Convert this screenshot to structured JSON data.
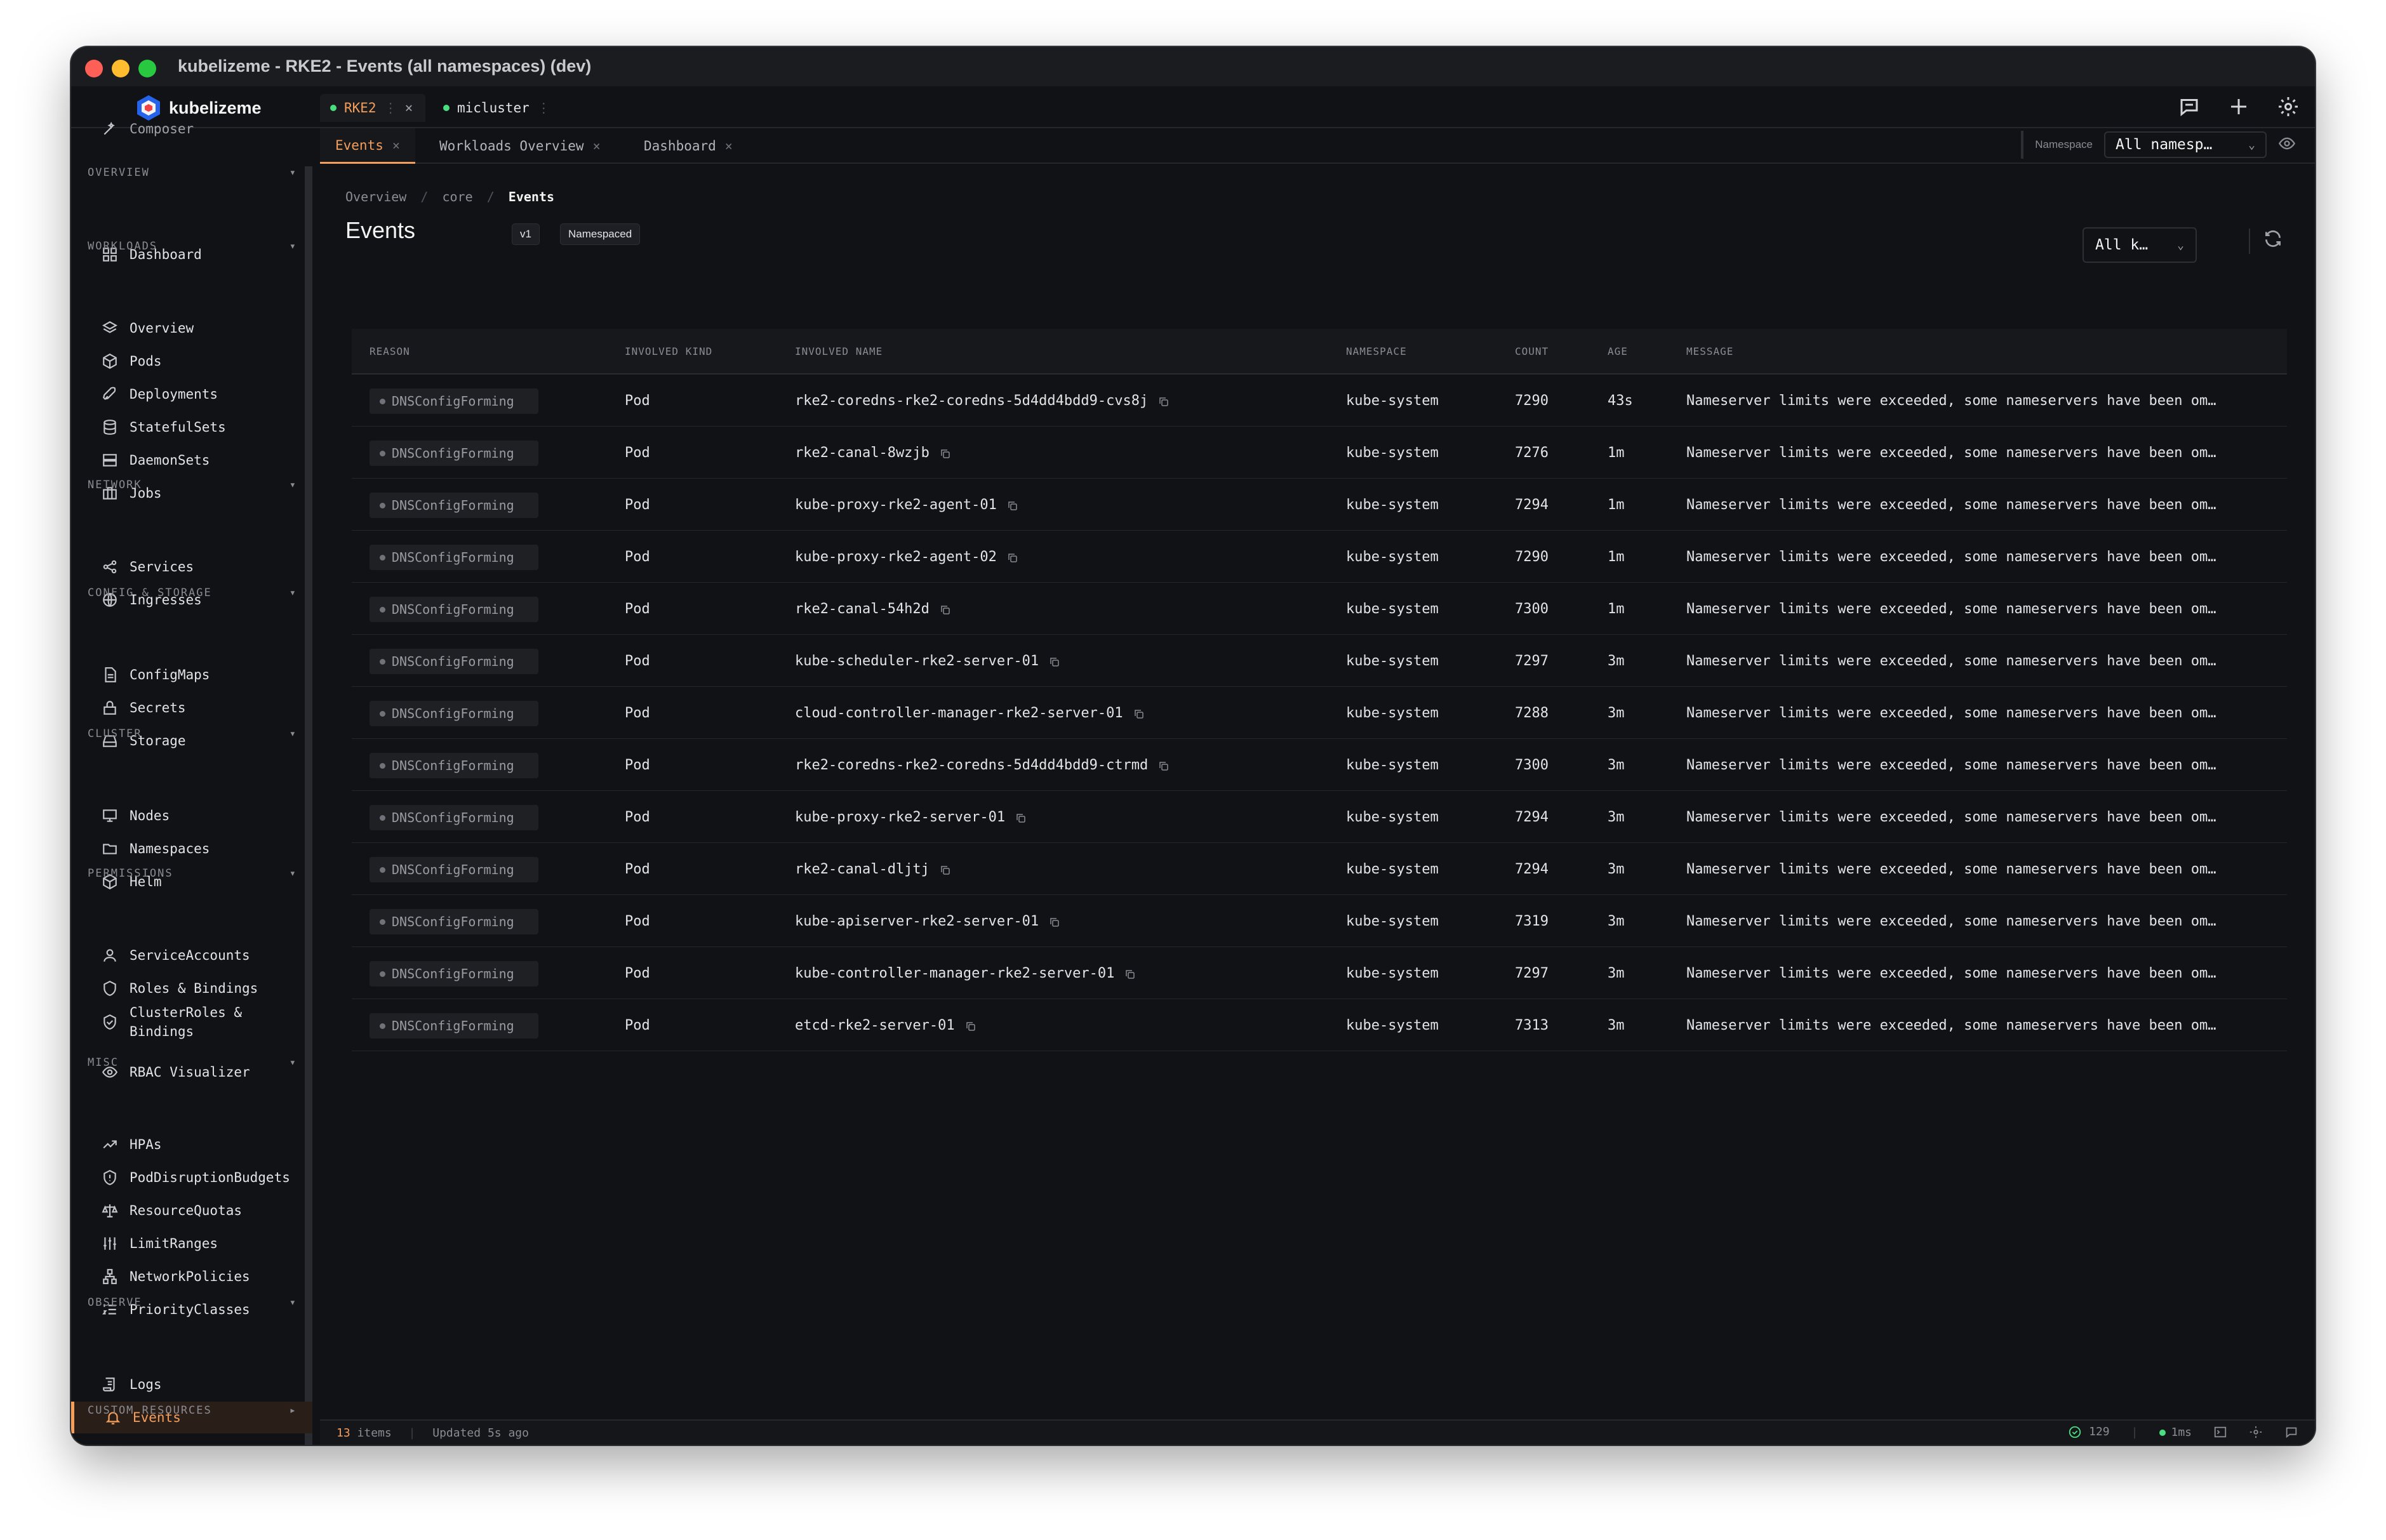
{
  "window": {
    "title": "kubelizeme - RKE2 - Events (all namespaces) (dev)"
  },
  "brand": {
    "name": "kubelizeme"
  },
  "context_tabs": [
    {
      "label": "RKE2",
      "close": "×"
    },
    {
      "label": "micluster",
      "menu": "⋮"
    }
  ],
  "sidebar": {
    "cut_item": "Composer",
    "sections": {
      "overview": "OVERVIEW",
      "workloads": "WORKLOADS",
      "network": "NETWORK",
      "config": "CONFIG & STORAGE",
      "cluster": "CLUSTER",
      "permissions": "PERMISSIONS",
      "misc": "MISC",
      "observe": "OBSERVE",
      "custom": "CUSTOM RESOURCES"
    },
    "items": {
      "dashboard": "Dashboard",
      "overview": "Overview",
      "pods": "Pods",
      "deployments": "Deployments",
      "statefulsets": "StatefulSets",
      "daemonsets": "DaemonSets",
      "jobs": "Jobs",
      "services": "Services",
      "ingresses": "Ingresses",
      "configmaps": "ConfigMaps",
      "secrets": "Secrets",
      "storage": "Storage",
      "nodes": "Nodes",
      "namespaces": "Namespaces",
      "helm": "Helm",
      "serviceaccounts": "ServiceAccounts",
      "roles": "Roles & Bindings",
      "clusterroles_1": "ClusterRoles &",
      "clusterroles_2": "Bindings",
      "rbac": "RBAC Visualizer",
      "hpas": "HPAs",
      "pdb": "PodDisruptionBudgets",
      "quotas": "ResourceQuotas",
      "limits": "LimitRanges",
      "netpol": "NetworkPolicies",
      "priority": "PriorityClasses",
      "logs": "Logs",
      "events": "Events"
    }
  },
  "page_tabs": [
    {
      "label": "Events"
    },
    {
      "label": "Workloads Overview"
    },
    {
      "label": "Dashboard"
    }
  ],
  "namespace": {
    "label": "Namespace",
    "value": "All namesp…"
  },
  "breadcrumb": {
    "a": "Overview",
    "b": "core",
    "c": "Events",
    "sep": "/"
  },
  "header": {
    "title": "Events",
    "version": "v1",
    "scope": "Namespaced",
    "kind_filter": "All k…"
  },
  "table": {
    "columns": [
      "REASON",
      "INVOLVED KIND",
      "INVOLVED NAME",
      "NAMESPACE",
      "COUNT",
      "AGE",
      "MESSAGE"
    ],
    "rows": [
      {
        "reason": "DNSConfigForming",
        "kind": "Pod",
        "name": "rke2-coredns-rke2-coredns-5d4dd4bdd9-cvs8j",
        "namespace": "kube-system",
        "count": "7290",
        "age": "43s",
        "message": "Nameserver limits were exceeded, some nameservers have been om…"
      },
      {
        "reason": "DNSConfigForming",
        "kind": "Pod",
        "name": "rke2-canal-8wzjb",
        "namespace": "kube-system",
        "count": "7276",
        "age": "1m",
        "message": "Nameserver limits were exceeded, some nameservers have been om…"
      },
      {
        "reason": "DNSConfigForming",
        "kind": "Pod",
        "name": "kube-proxy-rke2-agent-01",
        "namespace": "kube-system",
        "count": "7294",
        "age": "1m",
        "message": "Nameserver limits were exceeded, some nameservers have been om…"
      },
      {
        "reason": "DNSConfigForming",
        "kind": "Pod",
        "name": "kube-proxy-rke2-agent-02",
        "namespace": "kube-system",
        "count": "7290",
        "age": "1m",
        "message": "Nameserver limits were exceeded, some nameservers have been om…"
      },
      {
        "reason": "DNSConfigForming",
        "kind": "Pod",
        "name": "rke2-canal-54h2d",
        "namespace": "kube-system",
        "count": "7300",
        "age": "1m",
        "message": "Nameserver limits were exceeded, some nameservers have been om…"
      },
      {
        "reason": "DNSConfigForming",
        "kind": "Pod",
        "name": "kube-scheduler-rke2-server-01",
        "namespace": "kube-system",
        "count": "7297",
        "age": "3m",
        "message": "Nameserver limits were exceeded, some nameservers have been om…"
      },
      {
        "reason": "DNSConfigForming",
        "kind": "Pod",
        "name": "cloud-controller-manager-rke2-server-01",
        "namespace": "kube-system",
        "count": "7288",
        "age": "3m",
        "message": "Nameserver limits were exceeded, some nameservers have been om…"
      },
      {
        "reason": "DNSConfigForming",
        "kind": "Pod",
        "name": "rke2-coredns-rke2-coredns-5d4dd4bdd9-ctrmd",
        "namespace": "kube-system",
        "count": "7300",
        "age": "3m",
        "message": "Nameserver limits were exceeded, some nameservers have been om…"
      },
      {
        "reason": "DNSConfigForming",
        "kind": "Pod",
        "name": "kube-proxy-rke2-server-01",
        "namespace": "kube-system",
        "count": "7294",
        "age": "3m",
        "message": "Nameserver limits were exceeded, some nameservers have been om…"
      },
      {
        "reason": "DNSConfigForming",
        "kind": "Pod",
        "name": "rke2-canal-dljtj",
        "namespace": "kube-system",
        "count": "7294",
        "age": "3m",
        "message": "Nameserver limits were exceeded, some nameservers have been om…"
      },
      {
        "reason": "DNSConfigForming",
        "kind": "Pod",
        "name": "kube-apiserver-rke2-server-01",
        "namespace": "kube-system",
        "count": "7319",
        "age": "3m",
        "message": "Nameserver limits were exceeded, some nameservers have been om…"
      },
      {
        "reason": "DNSConfigForming",
        "kind": "Pod",
        "name": "kube-controller-manager-rke2-server-01",
        "namespace": "kube-system",
        "count": "7297",
        "age": "3m",
        "message": "Nameserver limits were exceeded, some nameservers have been om…"
      },
      {
        "reason": "DNSConfigForming",
        "kind": "Pod",
        "name": "etcd-rke2-server-01",
        "namespace": "kube-system",
        "count": "7313",
        "age": "3m",
        "message": "Nameserver limits were exceeded, some nameservers have been om…"
      }
    ]
  },
  "status": {
    "count": "13",
    "items_word": "items",
    "sep": "|",
    "updated": "Updated 5s ago",
    "checks": "129",
    "latency": "1ms"
  },
  "colors": {
    "accent": "#f59e5b",
    "ok": "#4ade80",
    "bg": "#111215"
  }
}
